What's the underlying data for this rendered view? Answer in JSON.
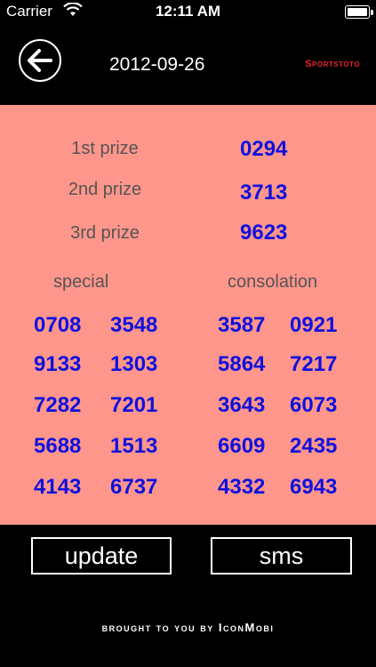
{
  "status_bar": {
    "carrier": "Carrier",
    "time": "12:11 AM"
  },
  "nav": {
    "date": "2012-09-26",
    "brand": "Sportstoto"
  },
  "prizes": [
    {
      "label": "1st prize",
      "value": "0294"
    },
    {
      "label": "2nd prize",
      "value": "3713"
    },
    {
      "label": "3rd prize",
      "value": "9623"
    }
  ],
  "special": {
    "label": "special",
    "numbers": [
      "0708",
      "3548",
      "9133",
      "1303",
      "7282",
      "7201",
      "5688",
      "1513",
      "4143",
      "6737"
    ]
  },
  "consolation": {
    "label": "consolation",
    "numbers": [
      "3587",
      "0921",
      "5864",
      "7217",
      "3643",
      "6073",
      "6609",
      "2435",
      "4332",
      "6943"
    ]
  },
  "buttons": {
    "update": "update",
    "sms": "sms"
  },
  "footer": "brought to you by IconMobi"
}
